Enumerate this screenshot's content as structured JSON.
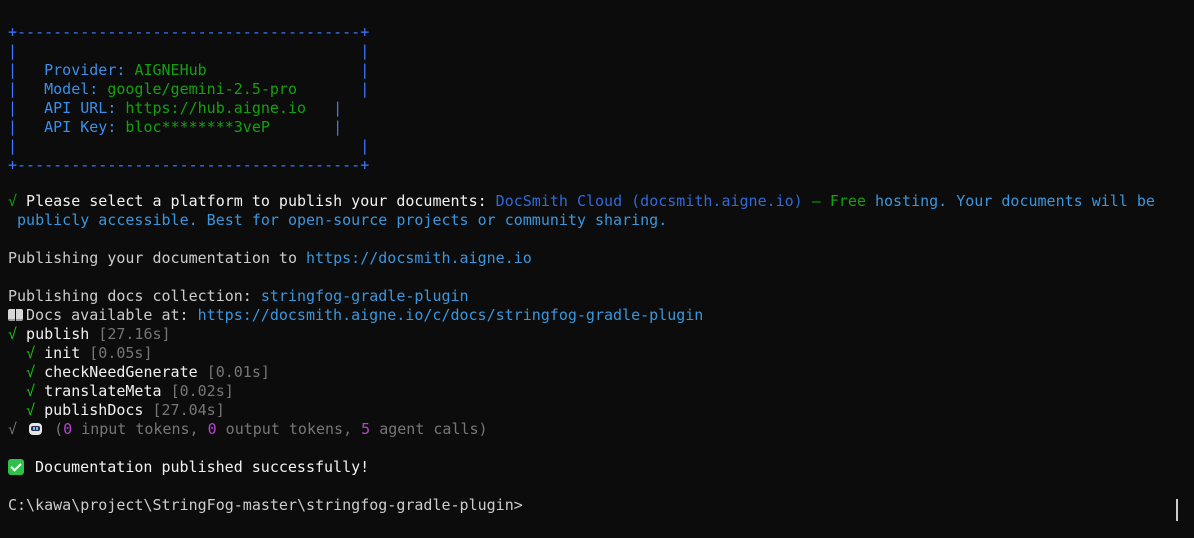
{
  "box": {
    "top_border": "+--------------------------------------+",
    "empty_row": "|                                      |",
    "bottom_border": "+--------------------------------------+",
    "rows": [
      {
        "label": "Provider: ",
        "value": "AIGNEHub",
        "pad": "                 "
      },
      {
        "label": "Model: ",
        "value": "google/gemini-2.5-pro",
        "pad": "       "
      },
      {
        "label": "API URL: ",
        "value": "https://hub.aigne.io",
        "pad": "   "
      },
      {
        "label": "API Key: ",
        "value": "bloc********3veP",
        "pad": "       "
      }
    ]
  },
  "select": {
    "check": "√",
    "question": " Please select a platform to publish your documents: ",
    "answer_name": "DocSmith Cloud (docsmith.aigne.io)",
    "dash": " – ",
    "free": "Free",
    "rest_line1": " hosting. Your documents will be",
    "rest_line2": " publicly accessible. Best for open-source projects or community sharing."
  },
  "publishing": {
    "prefix": "Publishing your documentation to ",
    "url": "https://docsmith.aigne.io"
  },
  "collection": {
    "prefix": "Publishing docs collection: ",
    "name": "stringfog-gradle-plugin"
  },
  "docs_available": {
    "icon": "open-book-icon",
    "prefix": "Docs available at: ",
    "url": "https://docsmith.aigne.io/c/docs/stringfog-gradle-plugin"
  },
  "tasks": [
    {
      "indent": "",
      "check": "√",
      "name": " publish ",
      "time": "[27.16s]"
    },
    {
      "indent": "  ",
      "check": "√",
      "name": " init ",
      "time": "[0.05s]"
    },
    {
      "indent": "  ",
      "check": "√",
      "name": " checkNeedGenerate ",
      "time": "[0.01s]"
    },
    {
      "indent": "  ",
      "check": "√",
      "name": " translateMeta ",
      "time": "[0.02s]"
    },
    {
      "indent": "  ",
      "check": "√",
      "name": " publishDocs ",
      "time": "[27.04s]"
    }
  ],
  "summary": {
    "check": "√",
    "icon": "robot-icon",
    "open": " (",
    "input_count": "0",
    "input_label": " input tokens, ",
    "output_count": "0",
    "output_label": " output tokens, ",
    "agent_count": "5",
    "agent_label": " agent calls)"
  },
  "success": {
    "icon": "check-mark-button-icon",
    "text": " Documentation published successfully!"
  },
  "prompt": {
    "text": "C:\\kawa\\project\\StringFog-master\\stringfog-gradle-plugin>"
  },
  "colors": {
    "background": "#0c0c0c",
    "foreground": "#cccccc",
    "border_blue": "#3b78ff",
    "label_blue": "#3b8eea",
    "value_green": "#13a10e",
    "link_cyan": "#3a96dd",
    "dim_gray": "#767676",
    "count_purple": "#b148c6"
  }
}
